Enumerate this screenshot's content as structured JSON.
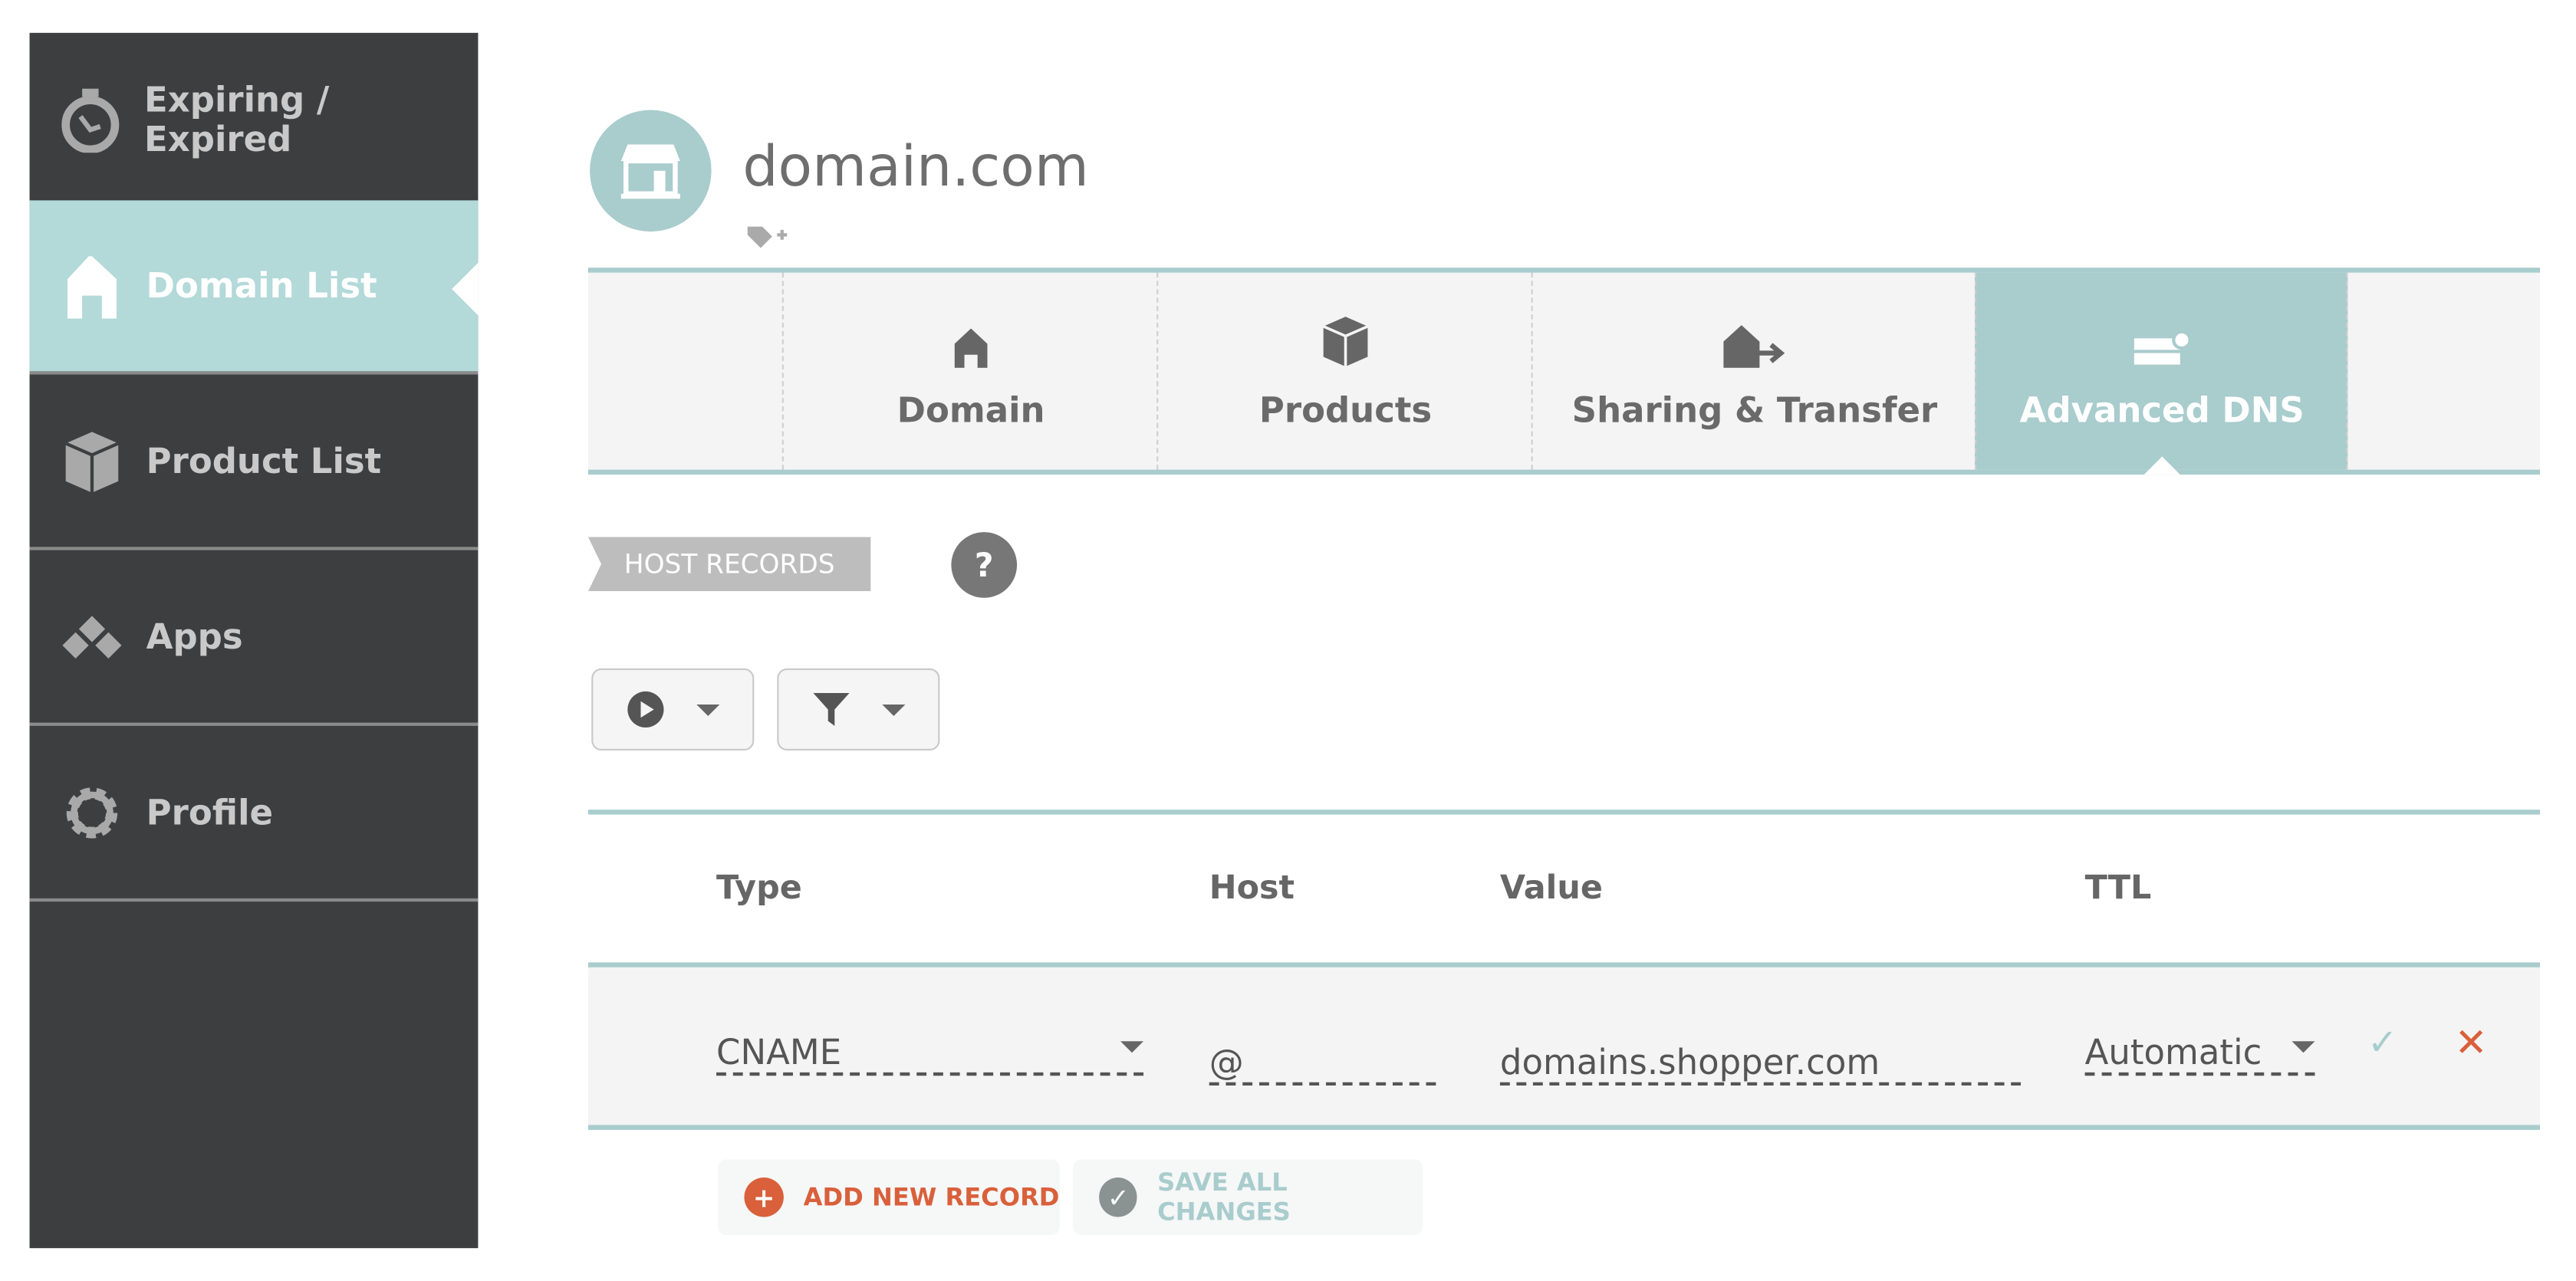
{
  "sidebar": {
    "items": [
      {
        "label": "Expiring / Expired",
        "icon": "stopwatch-icon"
      },
      {
        "label": "Domain List",
        "icon": "house-icon",
        "active": true
      },
      {
        "label": "Product List",
        "icon": "box-icon"
      },
      {
        "label": "Apps",
        "icon": "apps-icon"
      },
      {
        "label": "Profile",
        "icon": "gear-icon"
      }
    ]
  },
  "header": {
    "title": "domain.com",
    "avatar_icon": "storefront-icon",
    "tag_icon": "add-tag-icon"
  },
  "tabs": [
    {
      "label": "Domain",
      "icon": "house-icon"
    },
    {
      "label": "Products",
      "icon": "box-icon"
    },
    {
      "label": "Sharing & Transfer",
      "icon": "house-transfer-icon"
    },
    {
      "label": "Advanced DNS",
      "icon": "dns-server-icon",
      "active": true
    }
  ],
  "section": {
    "label": "HOST RECORDS",
    "help": "?"
  },
  "table": {
    "headers": [
      "Type",
      "Host",
      "Value",
      "TTL"
    ],
    "rows": [
      {
        "type": "CNAME",
        "host": "@",
        "value": "domains.shopper.com",
        "ttl": "Automatic"
      }
    ]
  },
  "actions": {
    "add": "ADD NEW RECORD",
    "save": "SAVE ALL CHANGES"
  },
  "colors": {
    "accent": "#a9cccd",
    "sidebar": "#3d3e40",
    "danger": "#d9603b",
    "active_side": "#b3d9d9"
  }
}
